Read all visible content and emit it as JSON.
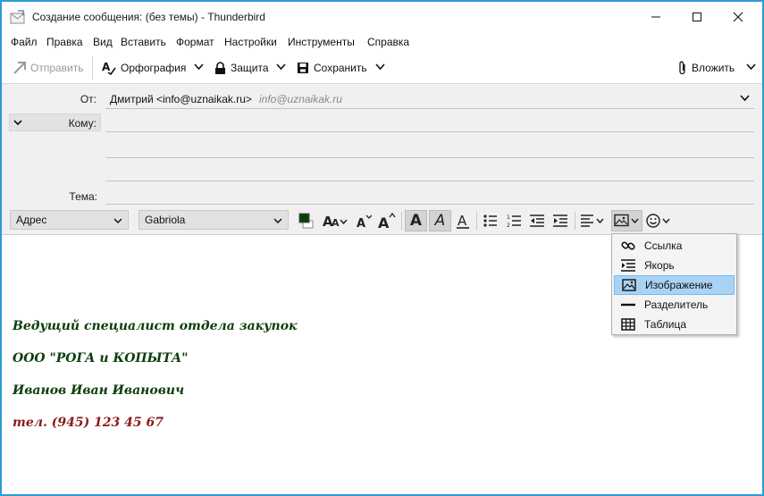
{
  "window": {
    "title": "Создание сообщения: (без темы) - Thunderbird"
  },
  "menu": [
    "Файл",
    "Правка",
    "Вид",
    "Вставить",
    "Формат",
    "Настройки",
    "Инструменты",
    "Справка"
  ],
  "toolbar": {
    "send": "Отправить",
    "spelling": "Орфография",
    "security": "Защита",
    "save": "Сохранить",
    "attach": "Вложить"
  },
  "headers": {
    "from_label": "От:",
    "from_value": "Дмитрий <info@uznaikak.ru>",
    "from_hint": "info@uznaikak.ru",
    "to_label": "Кому:",
    "subject_label": "Тема:"
  },
  "format": {
    "paragraph_style": "Адрес",
    "font": "Gabriola",
    "text_color": "#0b3d0b"
  },
  "insert_menu": [
    {
      "label": "Ссылка",
      "icon": "link-icon"
    },
    {
      "label": "Якорь",
      "icon": "anchor-icon"
    },
    {
      "label": "Изображение",
      "icon": "image-icon"
    },
    {
      "label": "Разделитель",
      "icon": "horizontal-line-icon"
    },
    {
      "label": "Таблица",
      "icon": "table-icon"
    }
  ],
  "signature": [
    "Ведущий специалист отдела закупок",
    "ООО \"РОГА и КОПЫТА\"",
    "Иванов Иван Иванович",
    "тел. (945) 123 45 67"
  ]
}
